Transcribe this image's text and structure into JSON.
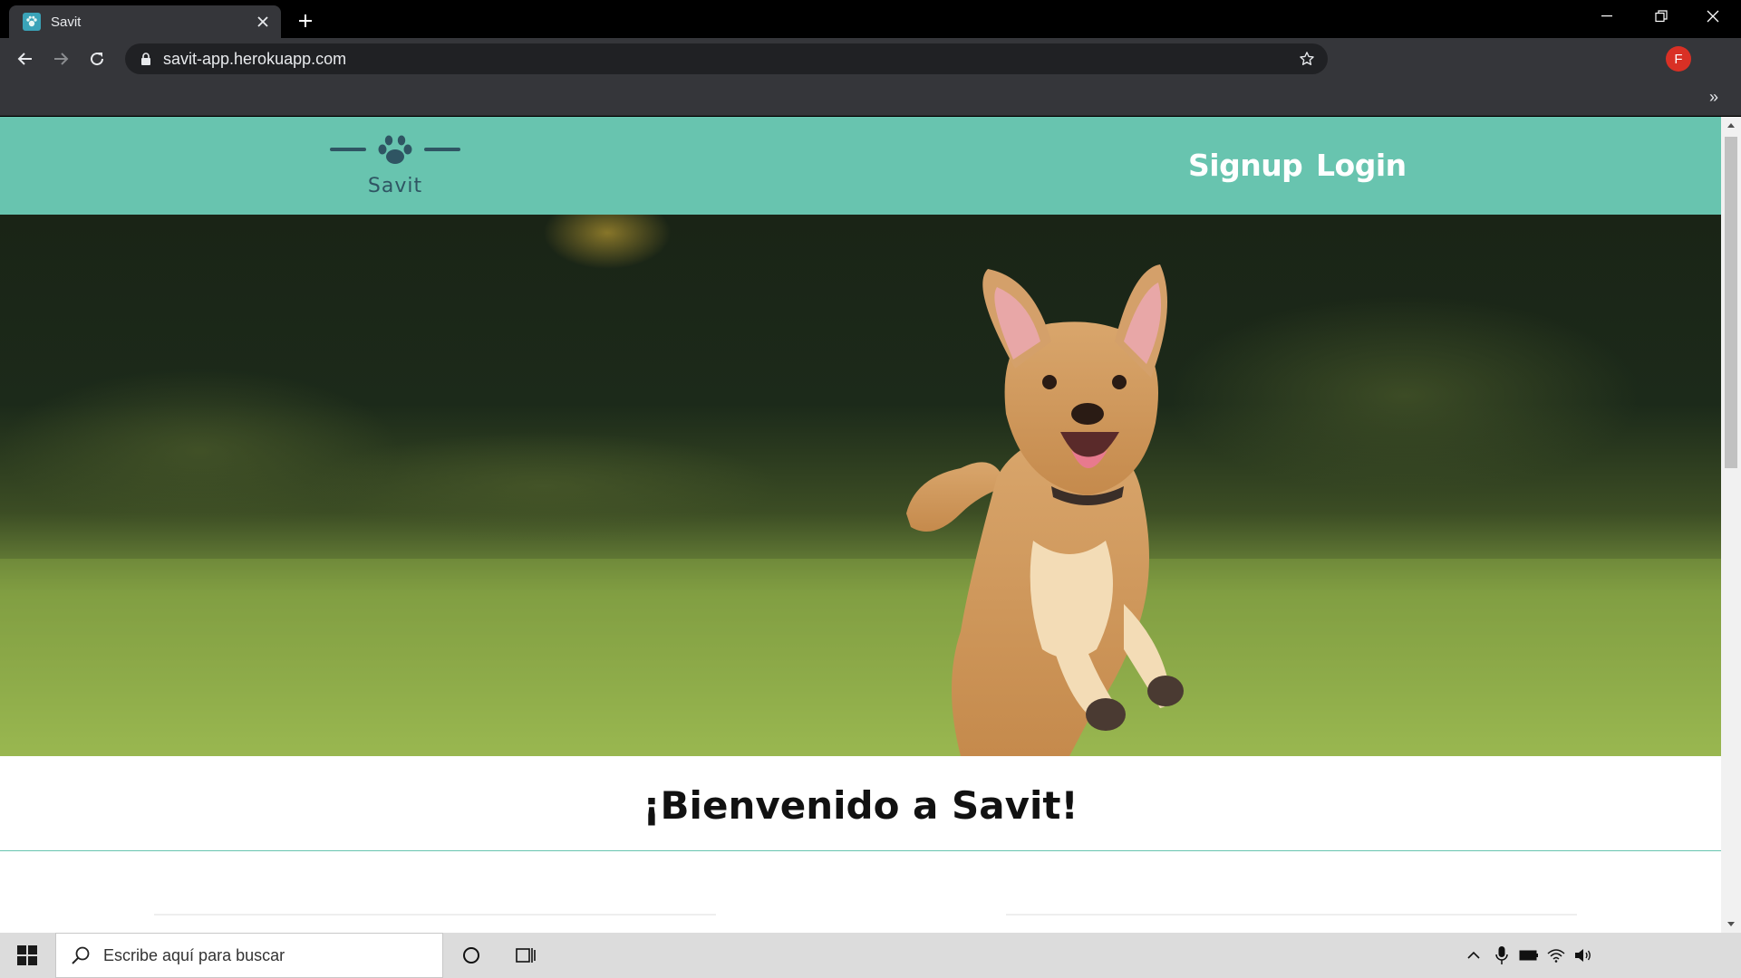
{
  "browser": {
    "tab": {
      "title": "Savit"
    },
    "url": "savit-app.herokuapp.com",
    "profile_initial": "F",
    "bookmarks_overflow": "»"
  },
  "site": {
    "logo_text": "Savit",
    "nav": {
      "signup": "Signup",
      "login": "Login"
    },
    "welcome": "¡Bienvenido a Savit!",
    "colors": {
      "brand": "#68c4af",
      "logo_ink": "#2f5563"
    }
  },
  "taskbar": {
    "search_placeholder": "Escribe aquí para buscar"
  }
}
